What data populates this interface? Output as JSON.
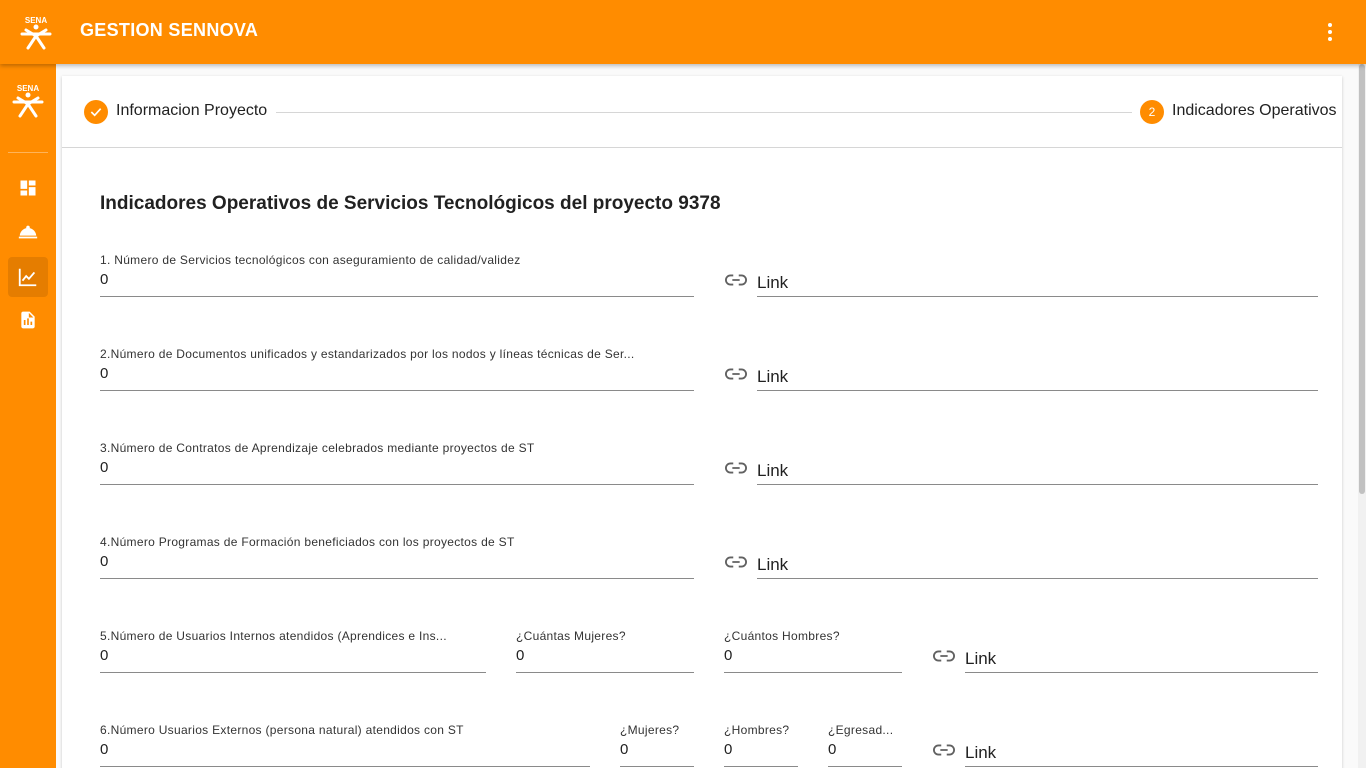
{
  "app": {
    "title": "GESTION SENNOVA",
    "logo_text": "SENA"
  },
  "stepper": {
    "steps": [
      {
        "label": "Informacion Proyecto",
        "icon": "check-icon"
      },
      {
        "number": "2",
        "label": "Indicadores Operativos"
      }
    ]
  },
  "heading": "Indicadores Operativos de Servicios Tecnológicos del proyecto 9378",
  "rows": [
    {
      "label": "1. Número de Servicios tecnológicos con aseguramiento de calidad/validez",
      "value": "0",
      "link": "Link"
    },
    {
      "label": "2.Número de Documentos unificados y estandarizados por los nodos y líneas técnicas de Ser...",
      "value": "0",
      "link": "Link"
    },
    {
      "label": "3.Número de Contratos de Aprendizaje celebrados mediante proyectos de ST",
      "value": "0",
      "link": "Link"
    },
    {
      "label": "4.Número Programas de Formación beneficiados con los proyectos de ST",
      "value": "0",
      "link": "Link"
    },
    {
      "label": "5.Número de Usuarios Internos atendidos (Aprendices e Ins...",
      "value": "0",
      "mujeres_label": "¿Cuántas Mujeres?",
      "mujeres_value": "0",
      "hombres_label": "¿Cuántos Hombres?",
      "hombres_value": "0",
      "link": "Link"
    },
    {
      "label": "6.Número Usuarios Externos (persona natural) atendidos con ST",
      "value": "0",
      "mujeres_label": "¿Mujeres?",
      "mujeres_value": "0",
      "hombres_label": "¿Hombres?",
      "hombres_value": "0",
      "egresados_label": "¿Egresad...",
      "egresados_value": "0",
      "link": "Link"
    }
  ],
  "colors": {
    "primary": "#ff8c00",
    "background": "#fafafa",
    "card": "#ffffff"
  }
}
